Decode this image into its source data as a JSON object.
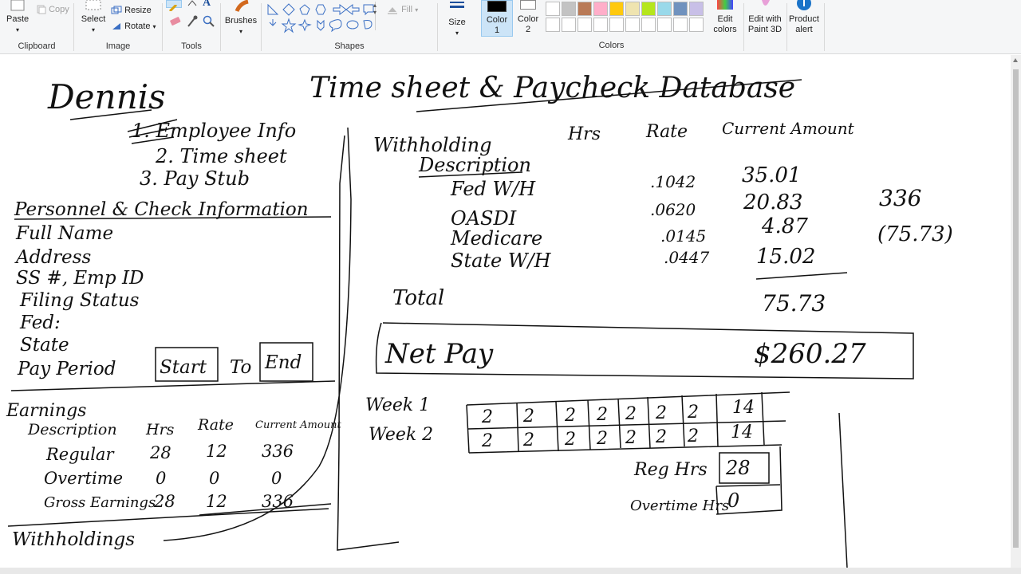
{
  "ribbon": {
    "clipboard": {
      "label": "Clipboard",
      "paste": "Paste",
      "copy": "Copy"
    },
    "image": {
      "label": "Image",
      "select": "Select",
      "resize": "Resize",
      "rotate": "Rotate"
    },
    "tools": {
      "label": "Tools"
    },
    "brushes": {
      "label": "Brushes"
    },
    "shapes": {
      "label": "Shapes",
      "fill": "Fill"
    },
    "size": {
      "label": "Size"
    },
    "color1": {
      "label": "Color",
      "num": "1",
      "value": "#000000"
    },
    "color2": {
      "label": "Color",
      "num": "2",
      "value": "#ffffff"
    },
    "colors": {
      "label": "Colors",
      "palette_row1": [
        "#ffffff",
        "#c3c3c3",
        "#b97a57",
        "#ffaec9",
        "#ffc90e",
        "#efe4b0",
        "#b5e61d",
        "#99d9ea",
        "#7092be",
        "#c8bfe7"
      ],
      "palette_row2": [
        "#ffffff",
        "#ffffff",
        "#ffffff",
        "#ffffff",
        "#ffffff",
        "#ffffff",
        "#ffffff",
        "#ffffff",
        "#ffffff",
        "#ffffff"
      ]
    },
    "edit_colors": {
      "line1": "Edit",
      "line2": "colors"
    },
    "paint3d": {
      "line1": "Edit with",
      "line2": "Paint 3D"
    },
    "product_alert": {
      "line1": "Product",
      "line2": "alert"
    }
  },
  "canvas": {
    "title_name": "Dennis",
    "title": "Time sheet & Paycheck Database",
    "list": [
      "1. Employee Info",
      "2. Time sheet",
      "3. Pay Stub"
    ],
    "personal": {
      "heading": "Personnel & Check Information",
      "fields": [
        "Full Name",
        "Address",
        "SS #, Emp ID",
        "Filing Status",
        "Fed:",
        "State"
      ],
      "pay_period": "Pay Period",
      "start": "Start",
      "to": "To",
      "end": "End"
    },
    "earnings": {
      "heading": "Earnings",
      "cols": [
        "Description",
        "Hrs",
        "Rate",
        "Current Amount"
      ],
      "rows": [
        {
          "desc": "Regular",
          "hrs": "28",
          "rate": "12",
          "amt": "336"
        },
        {
          "desc": "Overtime",
          "hrs": "0",
          "rate": "0",
          "amt": "0"
        },
        {
          "desc": "Gross Earnings",
          "hrs": "28",
          "rate": "12",
          "amt": "336"
        }
      ],
      "withholdings": "Withholdings"
    },
    "withholding": {
      "heading": "Withholding",
      "desc": "Description",
      "cols": [
        "Hrs",
        "Rate",
        "Current Amount"
      ],
      "rows": [
        {
          "desc": "Fed W/H",
          "rate": ".1042",
          "amt": "35.01"
        },
        {
          "desc": "OASDI",
          "rate": ".0620",
          "amt": "20.83"
        },
        {
          "desc": "Medicare",
          "rate": ".0145",
          "amt": "4.87"
        },
        {
          "desc": "State W/H",
          "rate": ".0447",
          "amt": "15.02"
        }
      ],
      "total_label": "Total",
      "total": "75.73",
      "side_gross": "336",
      "side_deduct": "(75.73)"
    },
    "net_pay": {
      "label": "Net Pay",
      "amount": "$260.27"
    },
    "timesheet": {
      "weeks": [
        {
          "label": "Week 1",
          "days": [
            "2",
            "2",
            "2",
            "2",
            "2",
            "2",
            "2"
          ],
          "total": "14"
        },
        {
          "label": "Week 2",
          "days": [
            "2",
            "2",
            "2",
            "2",
            "2",
            "2",
            "2"
          ],
          "total": "14"
        }
      ],
      "reg_label": "Reg Hrs",
      "reg": "28",
      "ot_label": "Overtime Hrs",
      "ot": "0"
    }
  }
}
